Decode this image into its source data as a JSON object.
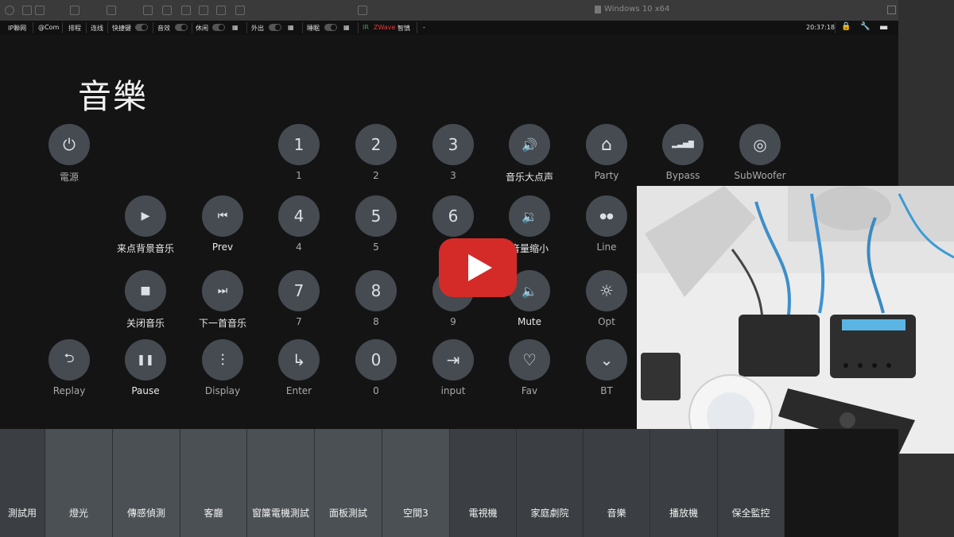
{
  "vm": {
    "title": "Windows 10 x64"
  },
  "toolbar": {
    "items": [
      "IP聯网",
      "@Com",
      "排程",
      "连线",
      "快捷键",
      "音效",
      "休闲",
      "外出",
      "睡眠"
    ],
    "status_green": "IR",
    "status_red": "ZWave",
    "status_text": "智慎",
    "dash": "-",
    "time": "20:37:18"
  },
  "page": {
    "title": "音樂"
  },
  "buttons": [
    {
      "icon": "⏻",
      "label": "電源"
    },
    {
      "icon": "1",
      "label": "1"
    },
    {
      "icon": "2",
      "label": "2"
    },
    {
      "icon": "3",
      "label": "3"
    },
    {
      "icon": "🔊",
      "label": "音乐大点声"
    },
    {
      "icon": "⌂",
      "label": "Party"
    },
    {
      "icon": "▂▃▅▇",
      "label": "Bypass"
    },
    {
      "icon": "◎",
      "label": "SubWoofer"
    },
    {
      "icon": "▶",
      "label": "来点背景音乐"
    },
    {
      "icon": "⏮",
      "label": "Prev"
    },
    {
      "icon": "4",
      "label": "4"
    },
    {
      "icon": "5",
      "label": "5"
    },
    {
      "icon": "6",
      "label": "6"
    },
    {
      "icon": "🔉",
      "label": "音量缩小"
    },
    {
      "icon": "●●",
      "label": "Line"
    },
    {
      "icon": "■",
      "label": "关闭音乐"
    },
    {
      "icon": "⏭",
      "label": "下一首音乐"
    },
    {
      "icon": "7",
      "label": "7"
    },
    {
      "icon": "8",
      "label": "8"
    },
    {
      "icon": "9",
      "label": "9"
    },
    {
      "icon": "🔈",
      "label": "Mute"
    },
    {
      "icon": "☼",
      "label": "Opt"
    },
    {
      "icon": "⮌",
      "label": "Replay"
    },
    {
      "icon": "❚❚",
      "label": "Pause"
    },
    {
      "icon": "⫶",
      "label": "Display"
    },
    {
      "icon": "↳",
      "label": "Enter"
    },
    {
      "icon": "0",
      "label": "0"
    },
    {
      "icon": "⇥",
      "label": "input"
    },
    {
      "icon": "♡",
      "label": "Fav"
    },
    {
      "icon": "⌄",
      "label": "BT"
    }
  ],
  "tabs": [
    "測試用",
    "燈光",
    "傳感偵測",
    "客廳",
    "窗簾電機測試",
    "面板測試",
    "空間3",
    "電視機",
    "家庭劇院",
    "音樂",
    "播放機",
    "保全監控"
  ],
  "icons": {
    "play_overlay": "youtube-play-icon",
    "colors": {
      "panel_bg": "#141414",
      "button_bg": "#464b52",
      "youtube_red": "#d52b28"
    }
  }
}
